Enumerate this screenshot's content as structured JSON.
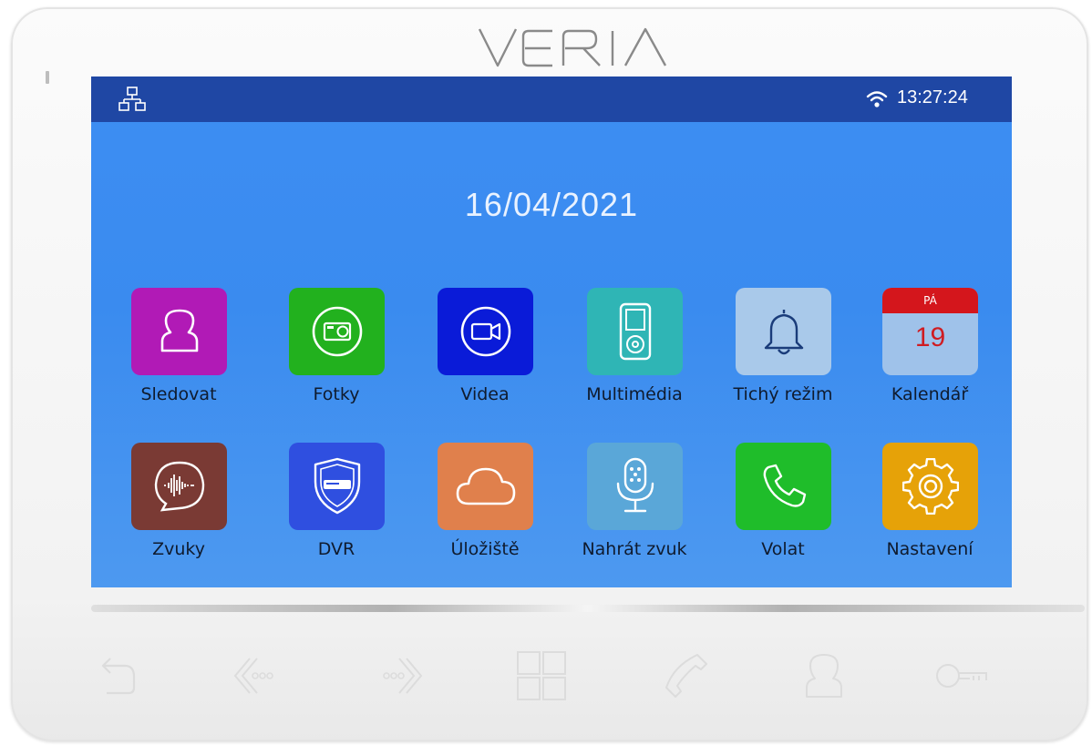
{
  "brand": "VERIA",
  "status": {
    "time": "13:27:24",
    "network_icon": "network-icon",
    "wifi_icon": "wifi-icon"
  },
  "date": "16/04/2021",
  "apps": [
    {
      "label": "Sledovat",
      "icon": "person-icon",
      "color": "#b11ab6"
    },
    {
      "label": "Fotky",
      "icon": "camera-icon",
      "color": "#22b11e"
    },
    {
      "label": "Videa",
      "icon": "video-camera-icon",
      "color": "#0a1bd8"
    },
    {
      "label": "Multimédia",
      "icon": "music-player-icon",
      "color": "#2fb5b5"
    },
    {
      "label": "Tichý režim",
      "icon": "bell-icon",
      "color": "#a9c9ea"
    },
    {
      "label": "Kalendář",
      "icon": "calendar-icon",
      "color": "#9fc2ea",
      "calendar": {
        "weekday": "PÁ",
        "day": "19"
      }
    },
    {
      "label": "Zvuky",
      "icon": "sound-wave-icon",
      "color": "#7a3a34"
    },
    {
      "label": "DVR",
      "icon": "dvr-shield-icon",
      "color": "#2f4fe0"
    },
    {
      "label": "Úložiště",
      "icon": "cloud-icon",
      "color": "#e0804c"
    },
    {
      "label": "Nahrát zvuk",
      "icon": "microphone-icon",
      "color": "#5aa7d8"
    },
    {
      "label": "Volat",
      "icon": "phone-icon",
      "color": "#1fbd2a"
    },
    {
      "label": "Nastavení",
      "icon": "gear-icon",
      "color": "#e6a208"
    }
  ],
  "hardware_buttons": [
    "back-icon",
    "previous-icon",
    "next-icon",
    "menu-grid-icon",
    "handset-icon",
    "monitor-person-icon",
    "key-icon"
  ]
}
